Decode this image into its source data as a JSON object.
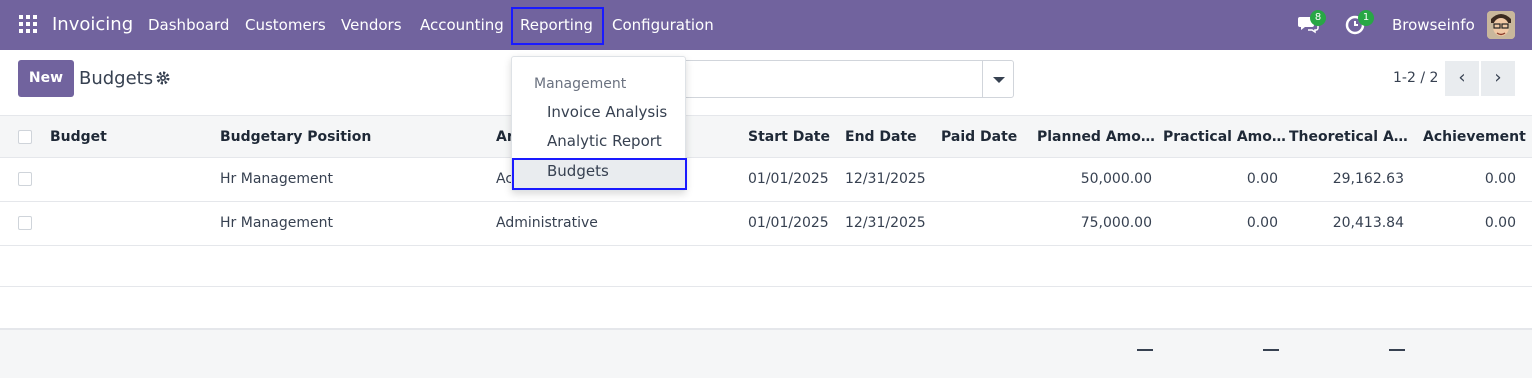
{
  "navbar": {
    "app_name": "Invoicing",
    "menu": [
      "Dashboard",
      "Customers",
      "Vendors",
      "Accounting",
      "Reporting",
      "Configuration"
    ],
    "messages_badge": "8",
    "activities_badge": "1",
    "company": "Browseinfo"
  },
  "control": {
    "new_label": "New",
    "title": "Budgets",
    "pager": "1-2 / 2",
    "prev": "‹",
    "next": "›"
  },
  "table": {
    "columns": [
      "Budget",
      "Budgetary Position",
      "An",
      "Start Date",
      "End Date",
      "Paid Date",
      "Planned Amo…",
      "Practical Amo…",
      "Theoretical A…",
      "Achievement"
    ],
    "rows": [
      {
        "budget": "",
        "position": "Hr Management",
        "analytic": "Ac",
        "start": "01/01/2025",
        "end": "12/31/2025",
        "paid": "",
        "planned": "50,000.00",
        "practical": "0.00",
        "theoretical": "29,162.63",
        "achievement": "0.00"
      },
      {
        "budget": "",
        "position": "Hr Management",
        "analytic": "Administrative",
        "start": "01/01/2025",
        "end": "12/31/2025",
        "paid": "",
        "planned": "75,000.00",
        "practical": "0.00",
        "theoretical": "20,413.84",
        "achievement": "0.00"
      }
    ]
  },
  "dropdown": {
    "section": "Management",
    "items": [
      "Invoice Analysis",
      "Analytic Report",
      "Budgets"
    ]
  },
  "colors": {
    "navbar": "#71639e",
    "highlight_border": "#1a1aff",
    "badge": "#28a745"
  },
  "icons": [
    "apps-grid-icon",
    "chat-icon",
    "clock-icon",
    "gear-icon",
    "caret-down-icon"
  ]
}
